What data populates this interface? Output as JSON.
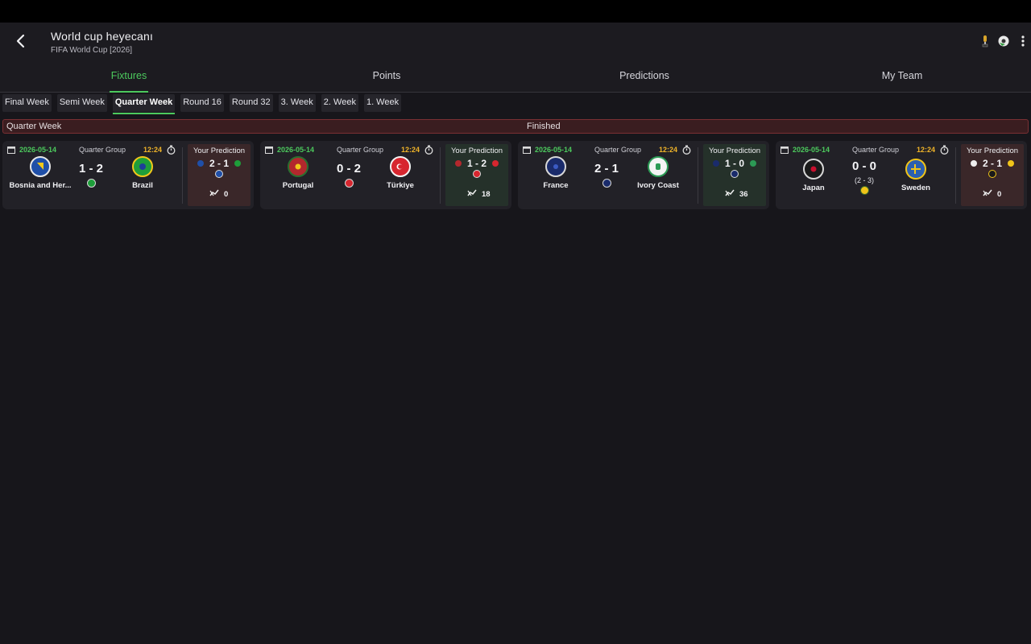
{
  "app": {
    "title": "World cup heyecanı",
    "subtitle": "FIFA World Cup [2026]",
    "actions": [
      "trophy-icon",
      "ball-icon",
      "more-vert-icon"
    ]
  },
  "tabs": [
    {
      "label": "Fixtures",
      "active": true
    },
    {
      "label": "Points",
      "active": false
    },
    {
      "label": "Predictions",
      "active": false
    },
    {
      "label": "My Team",
      "active": false
    }
  ],
  "weeks": [
    {
      "label": "Final Week",
      "active": false
    },
    {
      "label": "Semi Week",
      "active": false
    },
    {
      "label": "Quarter Week",
      "active": true
    },
    {
      "label": "Round 16",
      "active": false
    },
    {
      "label": "Round 32",
      "active": false
    },
    {
      "label": "3. Week",
      "active": false
    },
    {
      "label": "2. Week",
      "active": false
    },
    {
      "label": "1. Week",
      "active": false
    }
  ],
  "group_header": {
    "name": "Quarter Week",
    "status": "Finished"
  },
  "colors": {
    "accent_green": "#4cc95d",
    "time_yellow": "#f0b429",
    "finished_red": "#7a2f33"
  },
  "matches": [
    {
      "date": "2026-05-14",
      "group": "Quarter Group",
      "time": "12:24",
      "home": {
        "name": "Bosnia and Her...",
        "flag_color": "#1f4fa8"
      },
      "away": {
        "name": "Brazil",
        "flag_color": "#1e9e3a"
      },
      "score": "1  -  2",
      "penalties": "",
      "prediction": {
        "title": "Your Prediction",
        "score": "2 - 1",
        "points": "0",
        "result": "red"
      }
    },
    {
      "date": "2026-05-14",
      "group": "Quarter Group",
      "time": "12:24",
      "home": {
        "name": "Portugal",
        "flag_color": "#b3282d"
      },
      "away": {
        "name": "Türkiye",
        "flag_color": "#d7262f"
      },
      "score": "0  -  2",
      "penalties": "",
      "prediction": {
        "title": "Your Prediction",
        "score": "1 - 2",
        "points": "18",
        "result": "green"
      }
    },
    {
      "date": "2026-05-14",
      "group": "Quarter Group",
      "time": "12:24",
      "home": {
        "name": "France",
        "flag_color": "#1a2b6b"
      },
      "away": {
        "name": "Ivory Coast",
        "flag_color": "#2c9a55"
      },
      "score": "2  -  1",
      "penalties": "",
      "prediction": {
        "title": "Your Prediction",
        "score": "1 - 0",
        "points": "36",
        "result": "green"
      }
    },
    {
      "date": "2026-05-14",
      "group": "Quarter Group",
      "time": "12:24",
      "home": {
        "name": "Japan",
        "flag_color": "#c8102e"
      },
      "away": {
        "name": "Sweden",
        "flag_color": "#f0c419"
      },
      "score": "0  -  0",
      "penalties": "(2 - 3)",
      "prediction": {
        "title": "Your Prediction",
        "score": "2 - 1",
        "points": "0",
        "result": "red"
      }
    }
  ]
}
